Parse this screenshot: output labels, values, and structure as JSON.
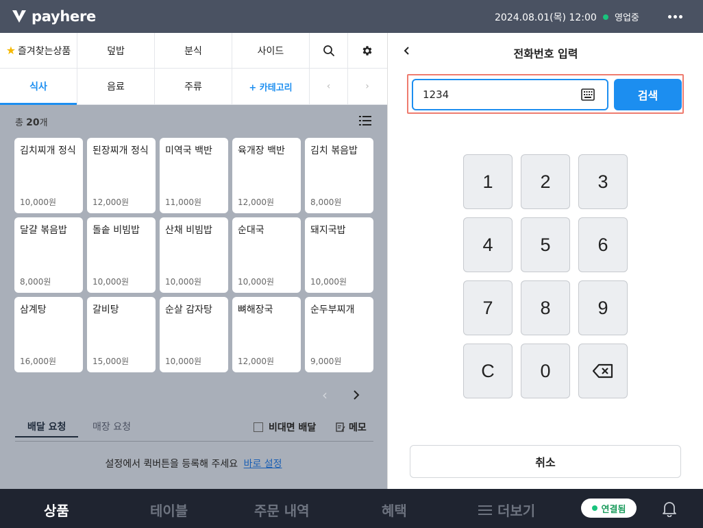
{
  "header": {
    "brand": "payhere",
    "datetime": "2024.08.01(목) 12:00",
    "status": "영업중",
    "colors": {
      "bar": "#4a5262",
      "status_dot": "#19c37d"
    }
  },
  "categories": {
    "row1": [
      "즐겨찾는상품",
      "덮밥",
      "분식",
      "사이드"
    ],
    "row2": [
      "식사",
      "음료",
      "주류"
    ],
    "add_category": "+ 카테고리",
    "active": "식사"
  },
  "products": {
    "total_prefix": "총",
    "total_count": "20",
    "total_suffix": "개",
    "items": [
      {
        "name": "김치찌개 정식",
        "price": "10,000원"
      },
      {
        "name": "된장찌개 정식",
        "price": "12,000원"
      },
      {
        "name": "미역국 백반",
        "price": "11,000원"
      },
      {
        "name": "육개장 백반",
        "price": "12,000원"
      },
      {
        "name": "김치 볶음밥",
        "price": "8,000원"
      },
      {
        "name": "달걀 볶음밥",
        "price": "8,000원"
      },
      {
        "name": "돌솥 비빔밥",
        "price": "10,000원"
      },
      {
        "name": "산채 비빔밥",
        "price": "10,000원"
      },
      {
        "name": "순대국",
        "price": "10,000원"
      },
      {
        "name": "돼지국밥",
        "price": "10,000원"
      },
      {
        "name": "삼계탕",
        "price": "16,000원"
      },
      {
        "name": "갈비탕",
        "price": "15,000원"
      },
      {
        "name": "순살 감자탕",
        "price": "10,000원"
      },
      {
        "name": "뼈해장국",
        "price": "12,000원"
      },
      {
        "name": "순두부찌개",
        "price": "9,000원"
      }
    ]
  },
  "request_tabs": {
    "delivery": "배달 요청",
    "store": "매장 요청",
    "contactless": "비대면 배달",
    "memo": "메모",
    "hint": "설정에서 퀵버튼을 등록해 주세요",
    "hint_link": "바로 설정"
  },
  "phone_panel": {
    "title": "전화번호 입력",
    "input_value": "1234",
    "search_label": "검색",
    "keys": [
      "1",
      "2",
      "3",
      "4",
      "5",
      "6",
      "7",
      "8",
      "9",
      "C",
      "0"
    ],
    "cancel_label": "취소",
    "colors": {
      "primary": "#1c8ef0",
      "highlight": "#ee7b6e"
    }
  },
  "bottom_nav": {
    "items": [
      "상품",
      "테이블",
      "주문 내역",
      "혜택",
      "더보기"
    ],
    "active": "상품",
    "connection": "연결됨"
  }
}
